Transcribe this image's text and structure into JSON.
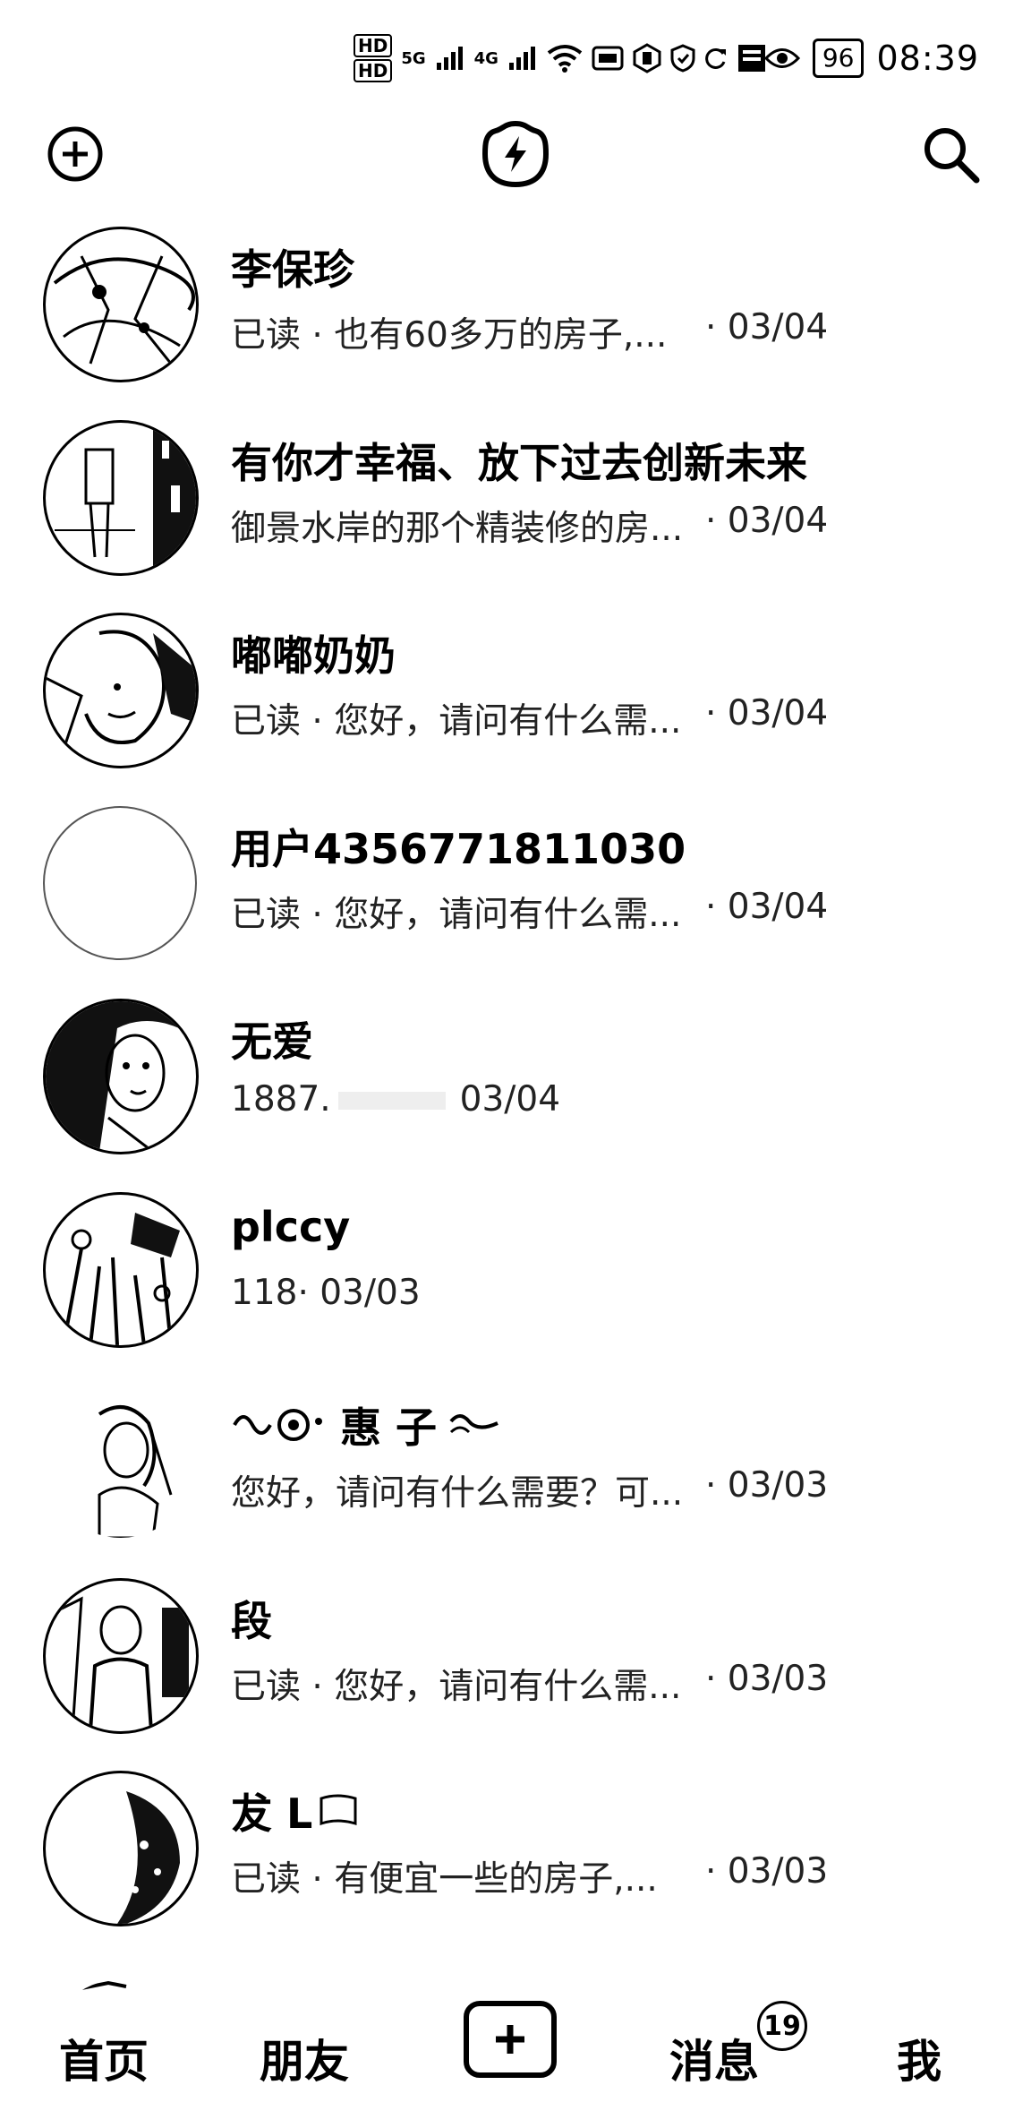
{
  "status_bar": {
    "hd1": "HD",
    "hd2": "HD",
    "net1": "5G",
    "net2": "4G",
    "battery": "96",
    "time": "08:39"
  },
  "header": {
    "left_icon": "add-circle-icon",
    "center_icon": "flash-icon",
    "right_icon": "search-icon"
  },
  "conversations": [
    {
      "name": "李保珍",
      "preview": "已读 · 也有60多万的房子,...",
      "date": " · 03/04"
    },
    {
      "name": "有你才幸福、放下过去创新未来",
      "preview": "御景水岸的那个精装修的房...",
      "date": " · 03/04"
    },
    {
      "name": "嘟嘟奶奶",
      "preview": "已读 · 您好，请问有什么需...",
      "date": " · 03/04"
    },
    {
      "name": "用户4356771811030",
      "preview": "已读 · 您好，请问有什么需...",
      "date": " · 03/04"
    },
    {
      "name": "无爱",
      "preview": "1887.",
      "date": "03/04"
    },
    {
      "name": "plccy",
      "preview": "118",
      "date": " · 03/03"
    },
    {
      "name": "惠 子",
      "preview": "您好，请问有什么需要？可...",
      "date": " · 03/03"
    },
    {
      "name": "段",
      "preview": "已读 · 您好，请问有什么需...",
      "date": " · 03/03"
    },
    {
      "name": "犮 L",
      "preview": "已读 · 有便宜一些的房子,...",
      "date": " · 03/03"
    }
  ],
  "nav": {
    "home": "首页",
    "friends": "朋友",
    "messages": "消息",
    "messages_badge": "19",
    "me": "我"
  }
}
